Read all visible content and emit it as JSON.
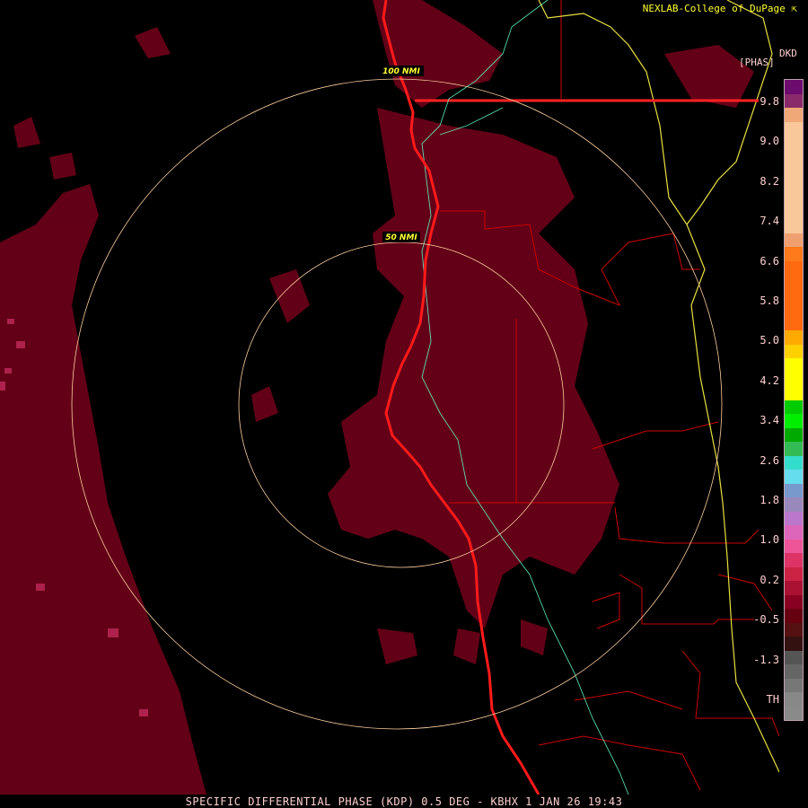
{
  "credit": "NEXLAB-College of DuPage",
  "credit_icon": "external-link-icon",
  "units": {
    "label": "DKD",
    "sub": "[PHAS]"
  },
  "footer": "SPECIFIC DIFFERENTIAL PHASE (KDP) 0.5 DEG - KBHX 1 JAN 26 19:43",
  "rings": [
    {
      "label": "100 NMI"
    },
    {
      "label": "50 NMI"
    }
  ],
  "legend": {
    "ticks": [
      "9.8",
      "9.0",
      "8.2",
      "7.4",
      "6.6",
      "5.8",
      "5.0",
      "4.2",
      "3.4",
      "2.6",
      "1.8",
      "1.0",
      "0.2",
      "-0.5",
      "-1.3",
      "TH"
    ],
    "colors": [
      "#6e0b6e",
      "#8a2a6a",
      "#f0a878",
      "#f8c89a",
      "#f8c89a",
      "#f8c89a",
      "#f8c89a",
      "#f8c89a",
      "#f8c89a",
      "#f8c89a",
      "#f8c89a",
      "#f0a070",
      "#ff7a1a",
      "#ff6a10",
      "#ff6a10",
      "#ff6a10",
      "#ff6a10",
      "#ff6a10",
      "#ffaa00",
      "#ffd000",
      "#ffff00",
      "#ffff00",
      "#ffff00",
      "#00cc00",
      "#00ee00",
      "#00aa00",
      "#33bb55",
      "#33ddcc",
      "#66ddee",
      "#7799cc",
      "#9988bb",
      "#bb77cc",
      "#dd66bb",
      "#ee5599",
      "#dd3366",
      "#cc2244",
      "#aa1133",
      "#880022",
      "#660011",
      "#551111",
      "#331111",
      "#555555",
      "#666666",
      "#777777",
      "#888888",
      "#8a8a8a"
    ],
    "scale_color": "#ffd0d0"
  },
  "colors": {
    "background": "#000000",
    "echo": "#6b0019",
    "coastline": "#ff1a1a",
    "county": "#cc0000",
    "state": "#ffff33",
    "river": "#66ffcc",
    "ring": "#ffd0a0"
  }
}
